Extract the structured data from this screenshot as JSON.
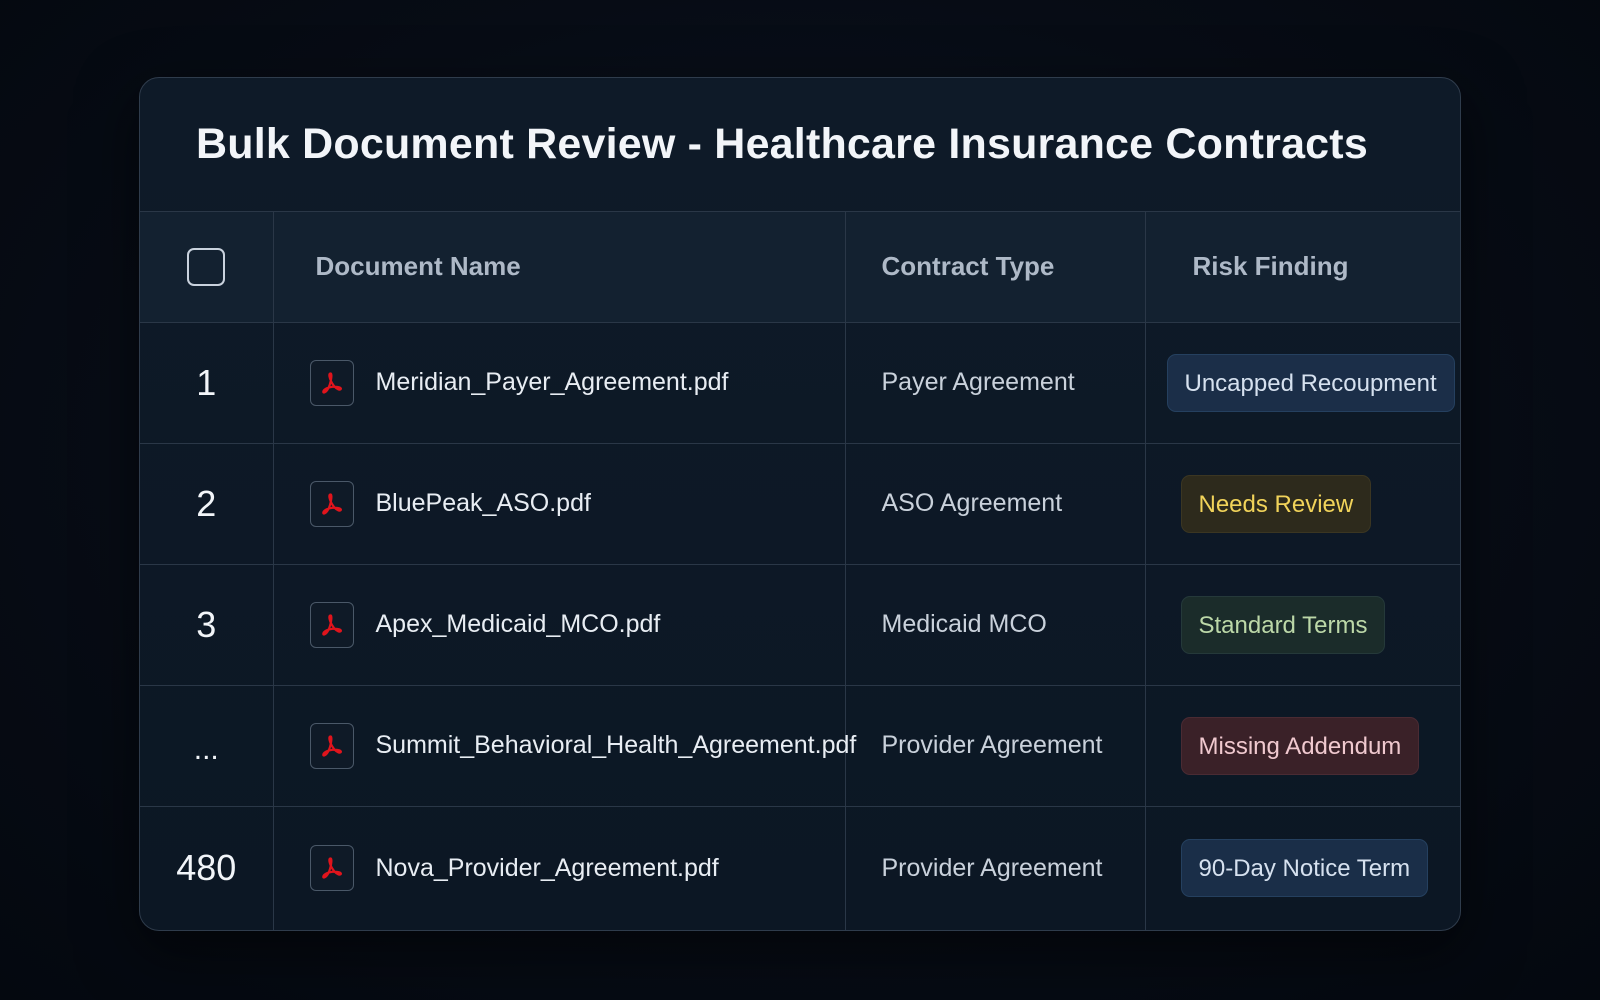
{
  "title": "Bulk Document Review - Healthcare Insurance Contracts",
  "columns": {
    "document_name": "Document Name",
    "contract_type": "Contract Type",
    "risk_finding": "Risk Finding"
  },
  "rows": [
    {
      "index": "1",
      "document": "Meridian_Payer_Agreement.pdf",
      "icon": "pdf-icon",
      "contract_type": "Payer Agreement",
      "risk": "Uncapped Recoupment",
      "risk_color": "#1b2e48"
    },
    {
      "index": "2",
      "document": "BluePeak_ASO.pdf",
      "icon": "pdf-icon",
      "contract_type": "ASO Agreement",
      "risk": "Needs Review",
      "risk_color": "#f1d35a"
    },
    {
      "index": "3",
      "document": "Apex_Medicaid_MCO.pdf",
      "icon": "pdf-icon",
      "contract_type": "Medicaid MCO",
      "risk": "Standard Terms",
      "risk_color": "#bcd8a8"
    },
    {
      "index": "...",
      "document": "Summit_Behavioral_Health_Agreement.pdf",
      "icon": "pdf-icon",
      "contract_type": "Provider Agreement",
      "risk": "Missing Addendum",
      "risk_color": "#3a2128"
    },
    {
      "index": "480",
      "document": "Nova_Provider_Agreement.pdf",
      "icon": "pdf-icon",
      "contract_type": "Provider Agreement",
      "risk": "90-Day Notice Term",
      "risk_color": "#1a2e48"
    }
  ],
  "colors": {
    "background": "#070c15",
    "card": "#0e1a28",
    "pdf_red": "#e0141c"
  }
}
